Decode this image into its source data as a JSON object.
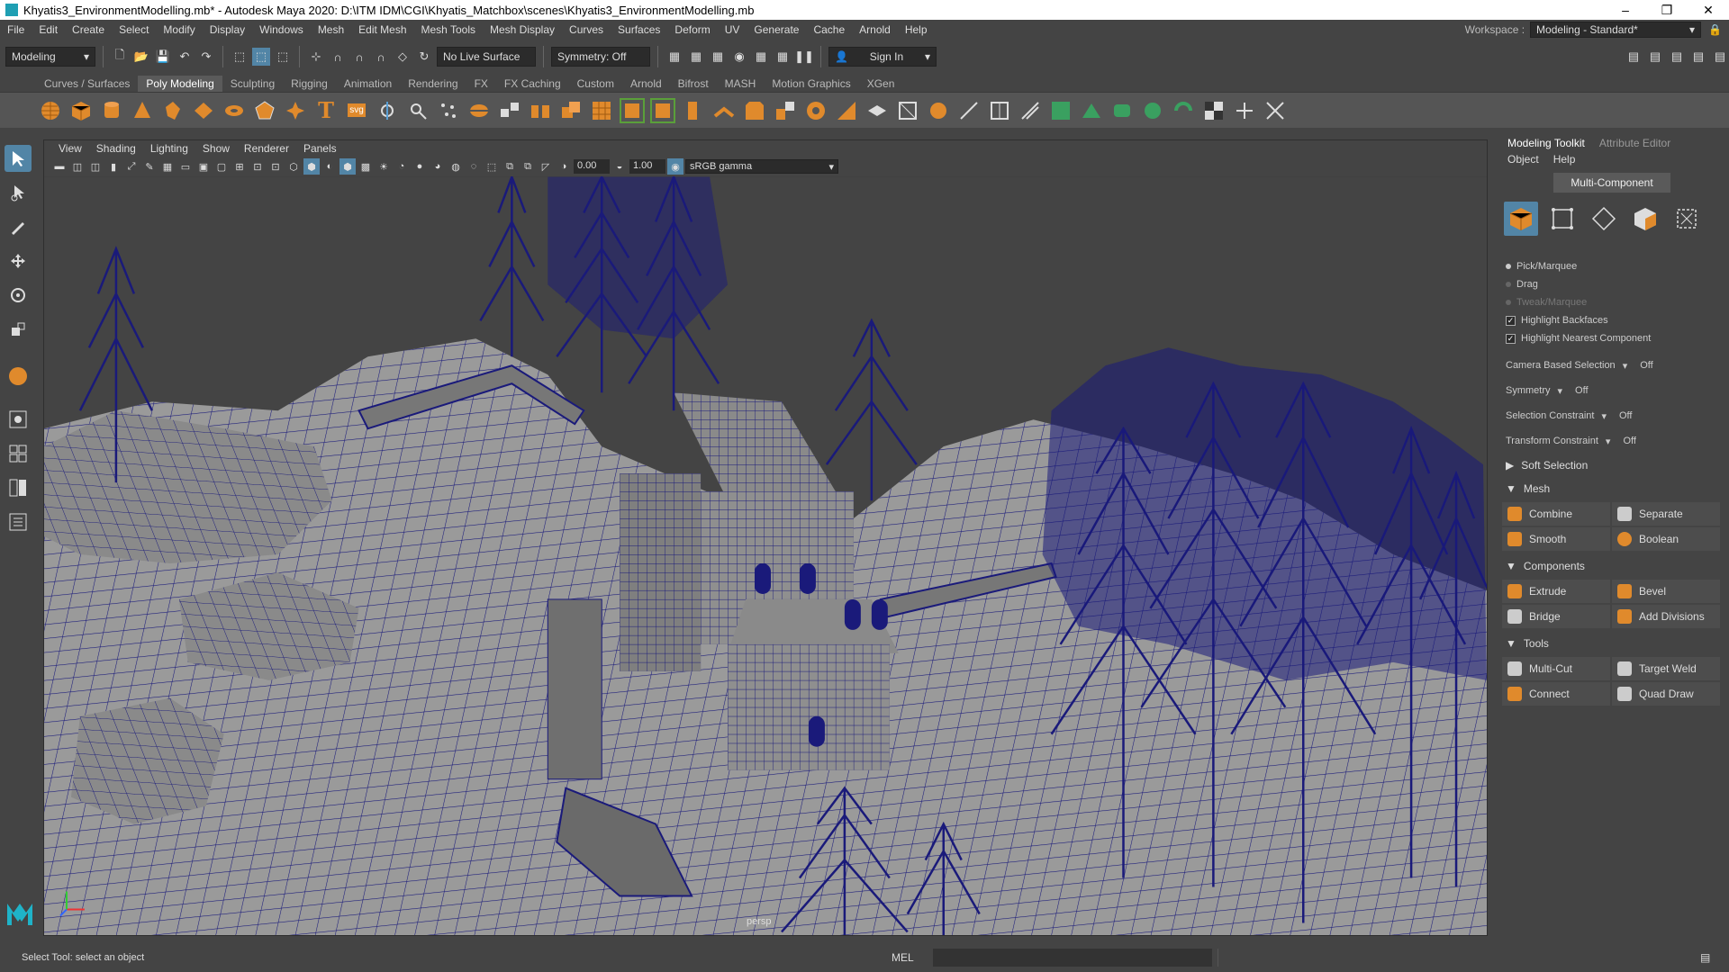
{
  "window": {
    "title": "Khyatis3_EnvironmentModelling.mb* - Autodesk Maya 2020: D:\\ITM IDM\\CGI\\Khyatis_Matchbox\\scenes\\Khyatis3_EnvironmentModelling.mb",
    "minimize": "–",
    "maximize": "❐",
    "close": "✕"
  },
  "menubar": {
    "items": [
      "File",
      "Edit",
      "Create",
      "Select",
      "Modify",
      "Display",
      "Windows",
      "Mesh",
      "Edit Mesh",
      "Mesh Tools",
      "Mesh Display",
      "Curves",
      "Surfaces",
      "Deform",
      "UV",
      "Generate",
      "Cache",
      "Arnold",
      "Help"
    ],
    "workspace_label": "Workspace :",
    "workspace_value": "Modeling - Standard*"
  },
  "statusline": {
    "menuset": "Modeling",
    "live_surface": "No Live Surface",
    "symmetry": "Symmetry: Off",
    "sign_in": "Sign In"
  },
  "shelf": {
    "tabs": [
      "Curves / Surfaces",
      "Poly Modeling",
      "Sculpting",
      "Rigging",
      "Animation",
      "Rendering",
      "FX",
      "FX Caching",
      "Custom",
      "Arnold",
      "Bifrost",
      "MASH",
      "Motion Graphics",
      "XGen"
    ],
    "active_tab": "Poly Modeling",
    "text_icon": "T",
    "svg_icon": "svg"
  },
  "viewport": {
    "menu": [
      "View",
      "Shading",
      "Lighting",
      "Show",
      "Renderer",
      "Panels"
    ],
    "exposure": "0.00",
    "gamma": "1.00",
    "color_space": "sRGB gamma",
    "camera": "persp"
  },
  "modeling_toolkit": {
    "tabs": [
      "Modeling Toolkit",
      "Attribute Editor"
    ],
    "menu": [
      "Object",
      "Help"
    ],
    "mode_button": "Multi-Component",
    "selection_modes": [
      "Pick/Marquee",
      "Drag",
      "Tweak/Marquee"
    ],
    "checks": [
      "Highlight Backfaces",
      "Highlight Nearest Component"
    ],
    "settings": [
      {
        "label": "Camera Based Selection",
        "value": "Off"
      },
      {
        "label": "Symmetry",
        "value": "Off"
      },
      {
        "label": "Selection Constraint",
        "value": "Off"
      },
      {
        "label": "Transform Constraint",
        "value": "Off"
      }
    ],
    "soft_selection": "Soft Selection",
    "sections": {
      "mesh": {
        "title": "Mesh",
        "buttons": [
          "Combine",
          "Separate",
          "Smooth",
          "Boolean"
        ]
      },
      "components": {
        "title": "Components",
        "buttons": [
          "Extrude",
          "Bevel",
          "Bridge",
          "Add Divisions"
        ]
      },
      "tools": {
        "title": "Tools",
        "buttons": [
          "Multi-Cut",
          "Target Weld",
          "Connect",
          "Quad Draw"
        ]
      }
    }
  },
  "bottombar": {
    "help_line": "Select Tool: select an object",
    "mel_label": "MEL"
  },
  "colors": {
    "wire": "#1a1a7a",
    "accent": "#5285a6",
    "orange": "#e08a2c"
  }
}
